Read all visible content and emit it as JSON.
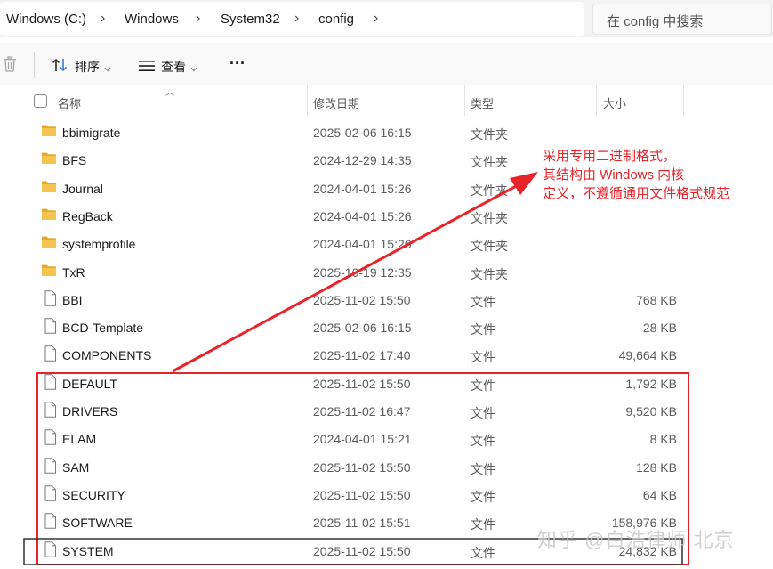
{
  "breadcrumb": [
    {
      "label": "Windows (C:)"
    },
    {
      "label": "Windows"
    },
    {
      "label": "System32"
    },
    {
      "label": "config"
    }
  ],
  "breadcrumb_separator": "›",
  "search": {
    "placeholder": "在 config 中搜索"
  },
  "toolbar": {
    "sort_label": "排序",
    "view_label": "查看",
    "more_label": "···"
  },
  "columns": {
    "name": "名称",
    "date": "修改日期",
    "type": "类型",
    "size": "大小"
  },
  "files": [
    {
      "name": "bbimigrate",
      "date": "2025-02-06 16:15",
      "type": "文件夹",
      "size": "",
      "kind": "folder"
    },
    {
      "name": "BFS",
      "date": "2024-12-29 14:35",
      "type": "文件夹",
      "size": "",
      "kind": "folder"
    },
    {
      "name": "Journal",
      "date": "2024-04-01 15:26",
      "type": "文件夹",
      "size": "",
      "kind": "folder"
    },
    {
      "name": "RegBack",
      "date": "2024-04-01 15:26",
      "type": "文件夹",
      "size": "",
      "kind": "folder"
    },
    {
      "name": "systemprofile",
      "date": "2024-04-01 15:26",
      "type": "文件夹",
      "size": "",
      "kind": "folder"
    },
    {
      "name": "TxR",
      "date": "2025-10-19 12:35",
      "type": "文件夹",
      "size": "",
      "kind": "folder"
    },
    {
      "name": "BBI",
      "date": "2025-11-02 15:50",
      "type": "文件",
      "size": "768 KB",
      "kind": "file"
    },
    {
      "name": "BCD-Template",
      "date": "2025-02-06 16:15",
      "type": "文件",
      "size": "28 KB",
      "kind": "file"
    },
    {
      "name": "COMPONENTS",
      "date": "2025-11-02 17:40",
      "type": "文件",
      "size": "49,664 KB",
      "kind": "file"
    },
    {
      "name": "DEFAULT",
      "date": "2025-11-02 15:50",
      "type": "文件",
      "size": "1,792 KB",
      "kind": "file"
    },
    {
      "name": "DRIVERS",
      "date": "2025-11-02 16:47",
      "type": "文件",
      "size": "9,520 KB",
      "kind": "file"
    },
    {
      "name": "ELAM",
      "date": "2024-04-01 15:21",
      "type": "文件",
      "size": "8 KB",
      "kind": "file"
    },
    {
      "name": "SAM",
      "date": "2025-11-02 15:50",
      "type": "文件",
      "size": "128 KB",
      "kind": "file"
    },
    {
      "name": "SECURITY",
      "date": "2025-11-02 15:50",
      "type": "文件",
      "size": "64 KB",
      "kind": "file"
    },
    {
      "name": "SOFTWARE",
      "date": "2025-11-02 15:51",
      "type": "文件",
      "size": "158,976 KB",
      "kind": "file"
    },
    {
      "name": "SYSTEM",
      "date": "2025-11-02 15:50",
      "type": "文件",
      "size": "24,832 KB",
      "kind": "file"
    }
  ],
  "annotation": {
    "lines": [
      "采用专用二进制格式，",
      "其结构由 Windows 内核",
      "定义，不遵循通用文件格式规范"
    ],
    "color": "#e8232a"
  },
  "watermark": "知乎 @白浩律师 北京",
  "colors": {
    "folder": "#f4c44e",
    "folder_dark": "#e5a92a",
    "accent_red": "#e8232a"
  }
}
